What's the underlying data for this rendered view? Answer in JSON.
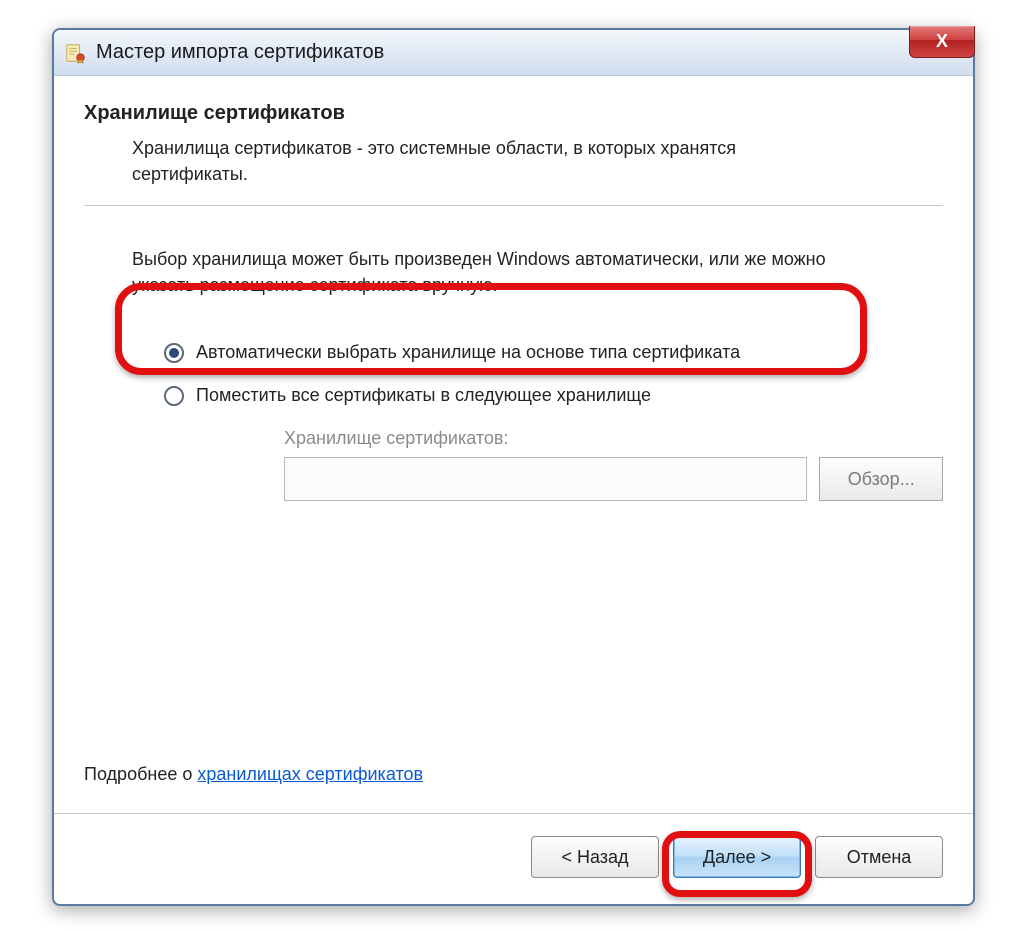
{
  "window": {
    "title": "Мастер импорта сертификатов",
    "closeGlyph": "X"
  },
  "page": {
    "heading": "Хранилище сертификатов",
    "subheading": "Хранилища сертификатов - это системные области, в которых хранятся сертификаты.",
    "choiceIntro": "Выбор хранилища может быть произведен Windows автоматически, или же можно указать размещение сертификата вручную.",
    "radios": {
      "auto": {
        "label": "Автоматически выбрать хранилище на основе типа сертификата",
        "selected": true
      },
      "manual": {
        "label": "Поместить все сертификаты в следующее хранилище",
        "selected": false
      }
    },
    "storeLabel": "Хранилище сертификатов:",
    "storeValue": "",
    "browse": "Обзор...",
    "moreInfoPrefix": "Подробнее о ",
    "moreInfoLink": "хранилищах сертификатов"
  },
  "footer": {
    "back": "< Назад",
    "next": "Далее >",
    "cancel": "Отмена"
  },
  "annotation": {
    "highlightedOption": "auto",
    "highlightedButton": "next"
  }
}
